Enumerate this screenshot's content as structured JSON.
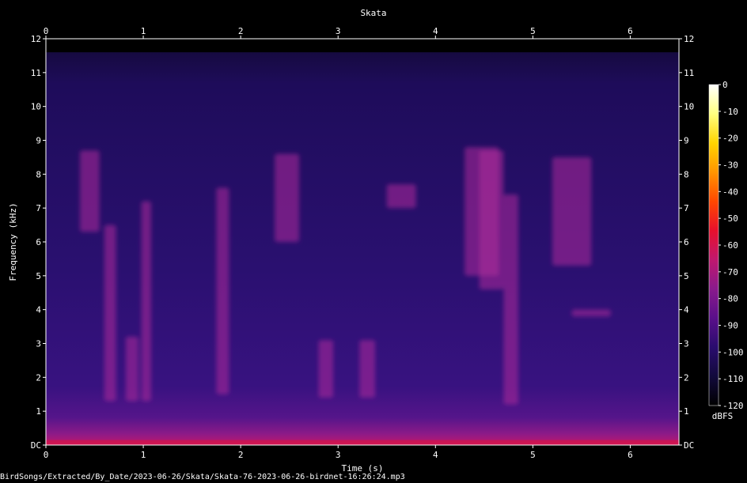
{
  "chart_data": {
    "type": "heatmap",
    "title": "Skata",
    "xlabel": "Time (s)",
    "ylabel": "Frequency (kHz)",
    "x_ticks": [
      "0",
      "1",
      "2",
      "3",
      "4",
      "5",
      "6"
    ],
    "xlim": [
      0,
      6.5
    ],
    "y_ticks": [
      "DC",
      "1",
      "2",
      "3",
      "4",
      "5",
      "6",
      "7",
      "8",
      "9",
      "10",
      "11",
      "12"
    ],
    "ylim": [
      0,
      12
    ],
    "signal_ceiling_khz": 11.6,
    "colorbar": {
      "label": "dBFS",
      "ticks": [
        "0",
        "-10",
        "-20",
        "-30",
        "-40",
        "-50",
        "-60",
        "-70",
        "-80",
        "-90",
        "-100",
        "-110",
        "-120"
      ],
      "range": [
        -120,
        0
      ],
      "colors": [
        "#000000",
        "#120a3c",
        "#2a0c6e",
        "#5a0f8a",
        "#8a1a8c",
        "#c0186e",
        "#e8102c",
        "#ff4800",
        "#ff9500",
        "#ffd400",
        "#ffff80",
        "#ffffff"
      ]
    },
    "calls": [
      {
        "t_start": 0.35,
        "t_end": 0.55,
        "f_low": 6.3,
        "f_high": 8.7
      },
      {
        "t_start": 0.6,
        "t_end": 0.72,
        "f_low": 1.3,
        "f_high": 6.5
      },
      {
        "t_start": 0.82,
        "t_end": 0.95,
        "f_low": 1.3,
        "f_high": 3.2
      },
      {
        "t_start": 0.98,
        "t_end": 1.08,
        "f_low": 1.3,
        "f_high": 7.2
      },
      {
        "t_start": 1.75,
        "t_end": 1.88,
        "f_low": 1.5,
        "f_high": 7.6
      },
      {
        "t_start": 2.35,
        "t_end": 2.6,
        "f_low": 6.0,
        "f_high": 8.6
      },
      {
        "t_start": 2.8,
        "t_end": 2.95,
        "f_low": 1.4,
        "f_high": 3.1
      },
      {
        "t_start": 3.22,
        "t_end": 3.38,
        "f_low": 1.4,
        "f_high": 3.1
      },
      {
        "t_start": 3.5,
        "t_end": 3.8,
        "f_low": 7.0,
        "f_high": 7.7
      },
      {
        "t_start": 4.3,
        "t_end": 4.65,
        "f_low": 5.0,
        "f_high": 8.8
      },
      {
        "t_start": 4.45,
        "t_end": 4.7,
        "f_low": 4.6,
        "f_high": 8.7
      },
      {
        "t_start": 4.7,
        "t_end": 4.85,
        "f_low": 1.2,
        "f_high": 7.4
      },
      {
        "t_start": 5.2,
        "t_end": 5.6,
        "f_low": 5.3,
        "f_high": 8.5
      },
      {
        "t_start": 5.4,
        "t_end": 5.8,
        "f_low": 3.8,
        "f_high": 4.0
      }
    ]
  },
  "footer": {
    "filename": "BirdSongs/Extracted/By_Date/2023-06-26/Skata/Skata-76-2023-06-26-birdnet-16:26:24.mp3"
  }
}
